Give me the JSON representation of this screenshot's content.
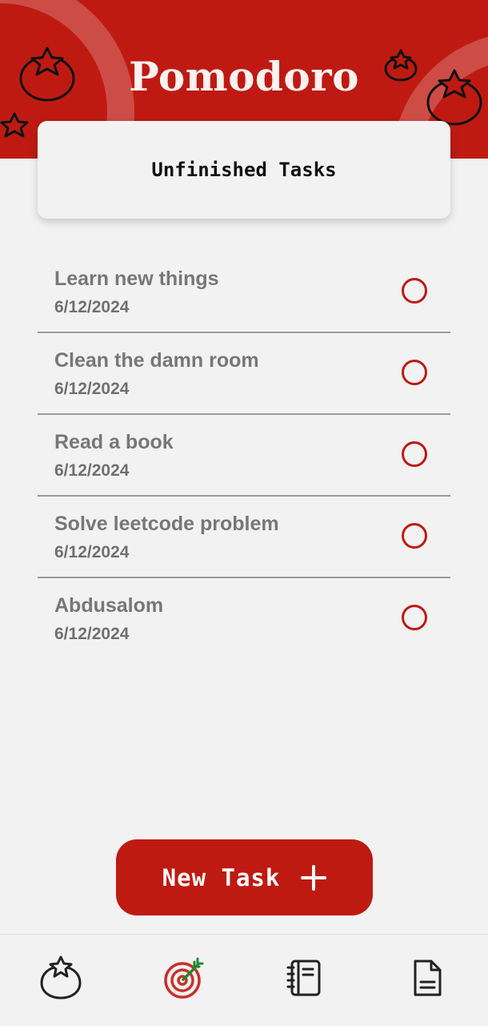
{
  "app": {
    "title": "Pomodoro",
    "brand_color": "#bf1a12"
  },
  "card": {
    "title": "Unfinished Tasks"
  },
  "tasks": [
    {
      "name": "Learn new things",
      "date": "6/12/2024",
      "done": false
    },
    {
      "name": "Clean the damn room",
      "date": "6/12/2024",
      "done": false
    },
    {
      "name": "Read a book",
      "date": "6/12/2024",
      "done": false
    },
    {
      "name": "Solve leetcode problem",
      "date": "6/12/2024",
      "done": false
    },
    {
      "name": "Abdusalom",
      "date": "6/12/2024",
      "done": false
    }
  ],
  "new_task_button": {
    "label": "New Task",
    "icon": "plus-icon"
  },
  "bottom_nav": [
    {
      "icon": "tomato-icon",
      "active": false
    },
    {
      "icon": "target-icon",
      "active": true
    },
    {
      "icon": "notebook-icon",
      "active": false
    },
    {
      "icon": "document-icon",
      "active": false
    }
  ]
}
